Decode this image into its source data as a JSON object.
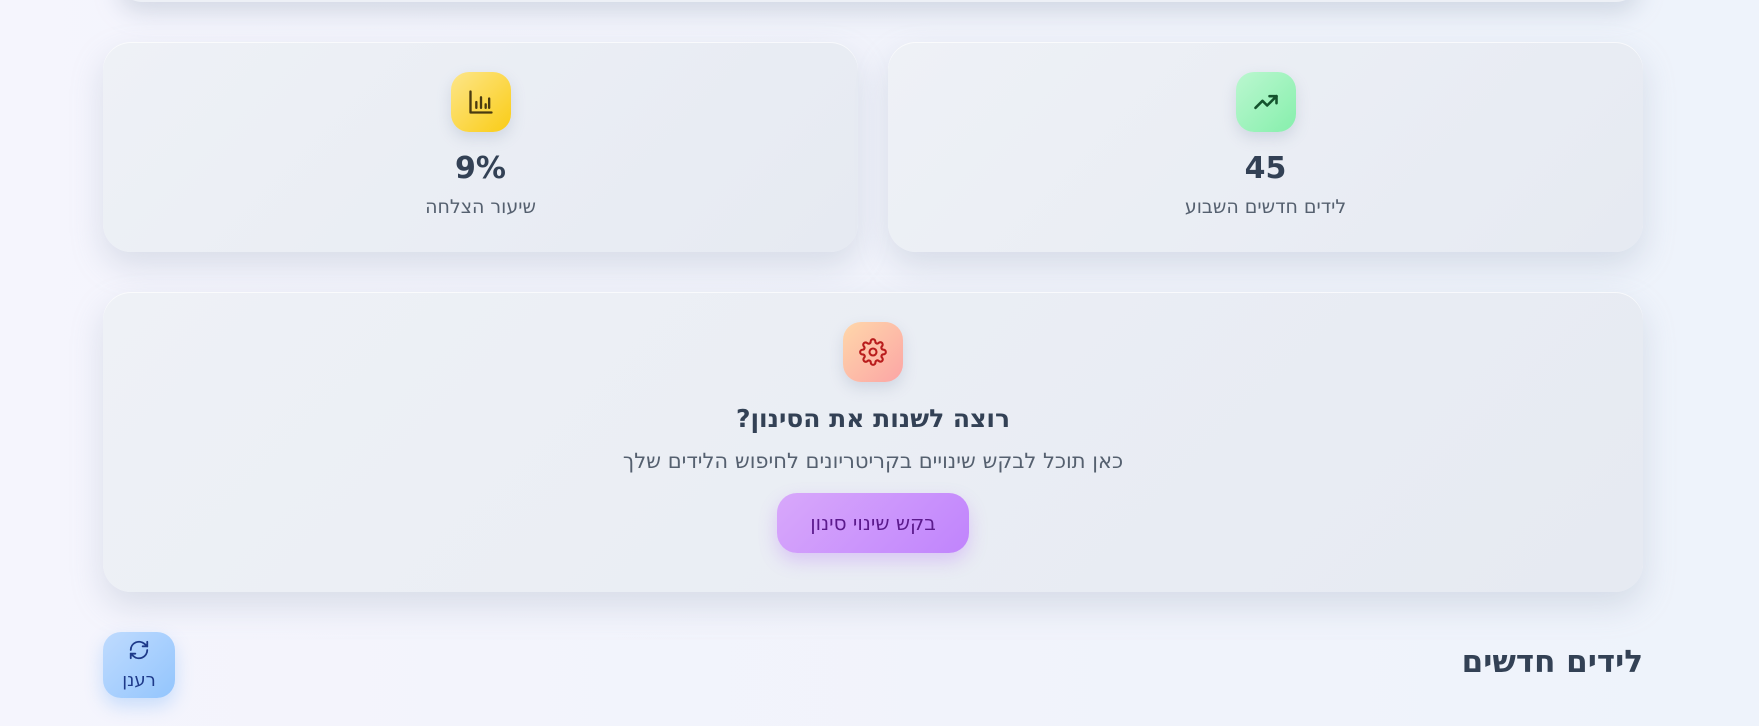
{
  "stats": {
    "success": {
      "value": "9%",
      "label": "שיעור הצלחה",
      "icon": "bar-chart-icon",
      "icon_color": "#facc15"
    },
    "new_leads": {
      "value": "45",
      "label": "לידים חדשים השבוע",
      "icon": "trending-up-icon",
      "icon_color": "#86efac"
    }
  },
  "filter_request": {
    "icon": "gear-icon",
    "icon_color": "#fca5a5",
    "title": "רוצה לשנות את הסינון?",
    "description": "כאן תוכל לבקש שינויים בקריטריונים לחיפוש הלידים שלך",
    "button_label": "בקש שינוי סינון",
    "button_color": "#c084fc"
  },
  "new_leads_section": {
    "title": "לידים חדשים",
    "refresh_label": "רענן",
    "refresh_icon": "refresh-icon",
    "refresh_color": "#93c5fd"
  }
}
